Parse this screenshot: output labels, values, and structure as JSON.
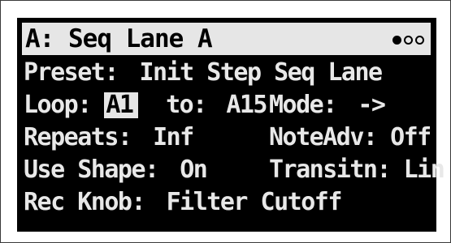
{
  "screen": {
    "title": "A: Seq Lane A",
    "pager": {
      "dots": [
        "filled",
        "empty",
        "empty"
      ]
    },
    "preset": {
      "label": "Preset:",
      "value": "Init Step Seq Lane"
    },
    "loop": {
      "label": "Loop:",
      "value": "A1",
      "to_label": "to:",
      "to_value": "A15"
    },
    "mode": {
      "label": "Mode:",
      "value": "->"
    },
    "repeats": {
      "label": "Repeats:",
      "value": "Inf"
    },
    "note_adv": {
      "label": "NoteAdv:",
      "value": "Off"
    },
    "use_shape": {
      "label": "Use Shape:",
      "value": "On"
    },
    "transition": {
      "label": "Transitn:",
      "value": "Lin"
    },
    "rec_knob": {
      "label": "Rec Knob:",
      "value": "Filter Cutoff"
    }
  },
  "colors": {
    "screen_bg": "#000000",
    "text": "#e8e8e8",
    "highlight_bg": "#e6e6e6",
    "highlight_text": "#000000"
  }
}
